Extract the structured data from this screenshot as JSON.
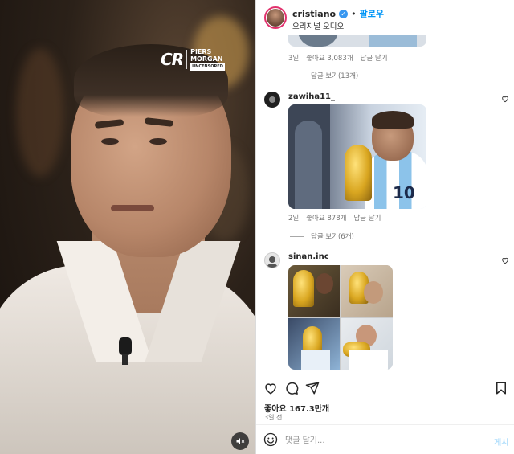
{
  "video": {
    "logo_mark": "CR",
    "logo_line1": "PIERS",
    "logo_line2": "MORGAN",
    "logo_line3": "UNCENSORED",
    "mute_icon": "speaker-muted-icon"
  },
  "header": {
    "username": "cristiano",
    "separator": "•",
    "follow_label": "팔로우",
    "audio_label": "오리지널 오디오"
  },
  "comments": [
    {
      "time": "3일",
      "likes": "좋아요 3,083개",
      "reply": "답글 달기",
      "view_replies": "답글 보기(13개)"
    },
    {
      "username": "zawiha11_",
      "time": "2일",
      "likes": "좋아요 878개",
      "reply": "답글 달기",
      "view_replies": "답글 보기(6개)"
    },
    {
      "username": "sinan.inc"
    }
  ],
  "actions": {
    "likes": "좋아요 167.3만개",
    "time": "3일 전"
  },
  "composer": {
    "placeholder": "댓글 달기...",
    "post_label": "게시"
  },
  "colors": {
    "accent": "#0095f6",
    "verified": "#3897f0",
    "post_disabled": "#b2dffc"
  }
}
